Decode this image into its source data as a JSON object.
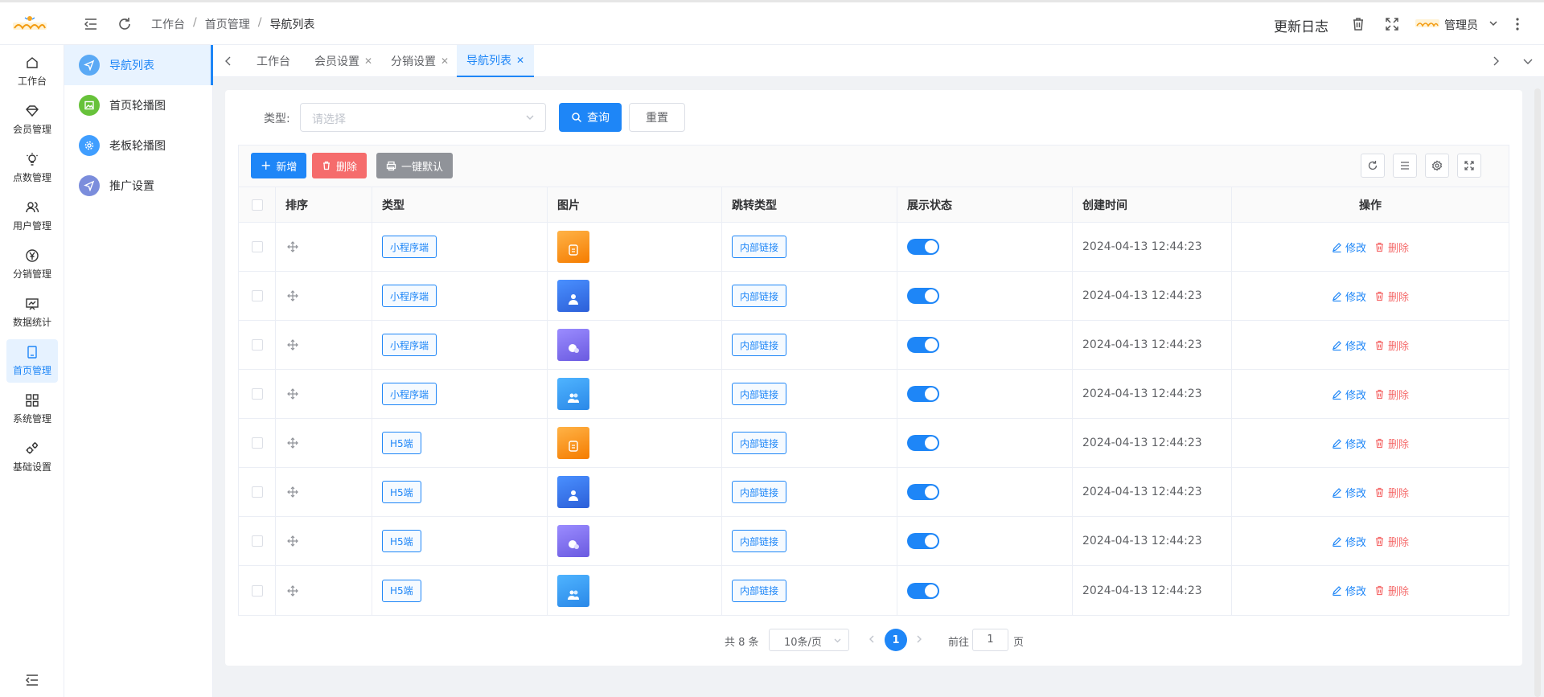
{
  "topbar": {
    "breadcrumb": [
      "工作台",
      "首页管理",
      "导航列表"
    ],
    "update_log": "更新日志",
    "user_name": "管理员"
  },
  "rail": [
    {
      "label": "工作台",
      "icon": "home-icon",
      "active": false
    },
    {
      "label": "会员管理",
      "icon": "diamond-icon",
      "active": false
    },
    {
      "label": "点数管理",
      "icon": "bulb-icon",
      "active": false
    },
    {
      "label": "用户管理",
      "icon": "users-icon",
      "active": false
    },
    {
      "label": "分销管理",
      "icon": "yen-icon",
      "active": false
    },
    {
      "label": "数据统计",
      "icon": "chart-board-icon",
      "active": false
    },
    {
      "label": "首页管理",
      "icon": "tablet-icon",
      "active": true
    },
    {
      "label": "系统管理",
      "icon": "grid-icon",
      "active": false
    },
    {
      "label": "基础设置",
      "icon": "gears-icon",
      "active": false
    }
  ],
  "submenu": [
    {
      "label": "导航列表",
      "icon": "navigation-icon",
      "color": "#5aa9f5",
      "active": true
    },
    {
      "label": "首页轮播图",
      "icon": "image-icon",
      "color": "#67c23a",
      "active": false
    },
    {
      "label": "老板轮播图",
      "icon": "settings-icon",
      "color": "#409eff",
      "active": false
    },
    {
      "label": "推广设置",
      "icon": "navigation-icon",
      "color": "#7b8ddc",
      "active": false
    }
  ],
  "tabs": [
    {
      "label": "工作台",
      "closable": false,
      "active": false
    },
    {
      "label": "会员设置",
      "closable": true,
      "active": false
    },
    {
      "label": "分销设置",
      "closable": true,
      "active": false
    },
    {
      "label": "导航列表",
      "closable": true,
      "active": true
    }
  ],
  "filter": {
    "type_label": "类型:",
    "type_placeholder": "请选择",
    "query_label": "查询",
    "reset_label": "重置"
  },
  "toolbar": {
    "add_label": "新增",
    "delete_label": "删除",
    "default_label": "一键默认"
  },
  "table": {
    "headers": [
      "排序",
      "类型",
      "图片",
      "跳转类型",
      "展示状态",
      "创建时间",
      "操作"
    ],
    "edit_label": "修改",
    "delete_label": "删除",
    "rows": [
      {
        "type": "小程序端",
        "jump_type": "内部链接",
        "enabled": true,
        "created": "2024-04-13 12:44:23",
        "image": "orange-badge-icon"
      },
      {
        "type": "小程序端",
        "jump_type": "内部链接",
        "enabled": true,
        "created": "2024-04-13 12:44:23",
        "image": "blue-user-icon"
      },
      {
        "type": "小程序端",
        "jump_type": "内部链接",
        "enabled": true,
        "created": "2024-04-13 12:44:23",
        "image": "purple-coin-icon"
      },
      {
        "type": "小程序端",
        "jump_type": "内部链接",
        "enabled": true,
        "created": "2024-04-13 12:44:23",
        "image": "sky-users-icon"
      },
      {
        "type": "H5端",
        "jump_type": "内部链接",
        "enabled": true,
        "created": "2024-04-13 12:44:23",
        "image": "orange-badge-icon"
      },
      {
        "type": "H5端",
        "jump_type": "内部链接",
        "enabled": true,
        "created": "2024-04-13 12:44:23",
        "image": "blue-user-icon"
      },
      {
        "type": "H5端",
        "jump_type": "内部链接",
        "enabled": true,
        "created": "2024-04-13 12:44:23",
        "image": "purple-coin-icon"
      },
      {
        "type": "H5端",
        "jump_type": "内部链接",
        "enabled": true,
        "created": "2024-04-13 12:44:23",
        "image": "sky-users-icon"
      }
    ]
  },
  "pagination": {
    "total_text": "共 8 条",
    "page_size": "10条/页",
    "current_page": "1",
    "goto_label": "前往",
    "goto_value": "1",
    "page_suffix": "页"
  },
  "colors": {
    "primary": "#1e86f7",
    "danger": "#f56c6c",
    "gray_button": "#909399"
  }
}
